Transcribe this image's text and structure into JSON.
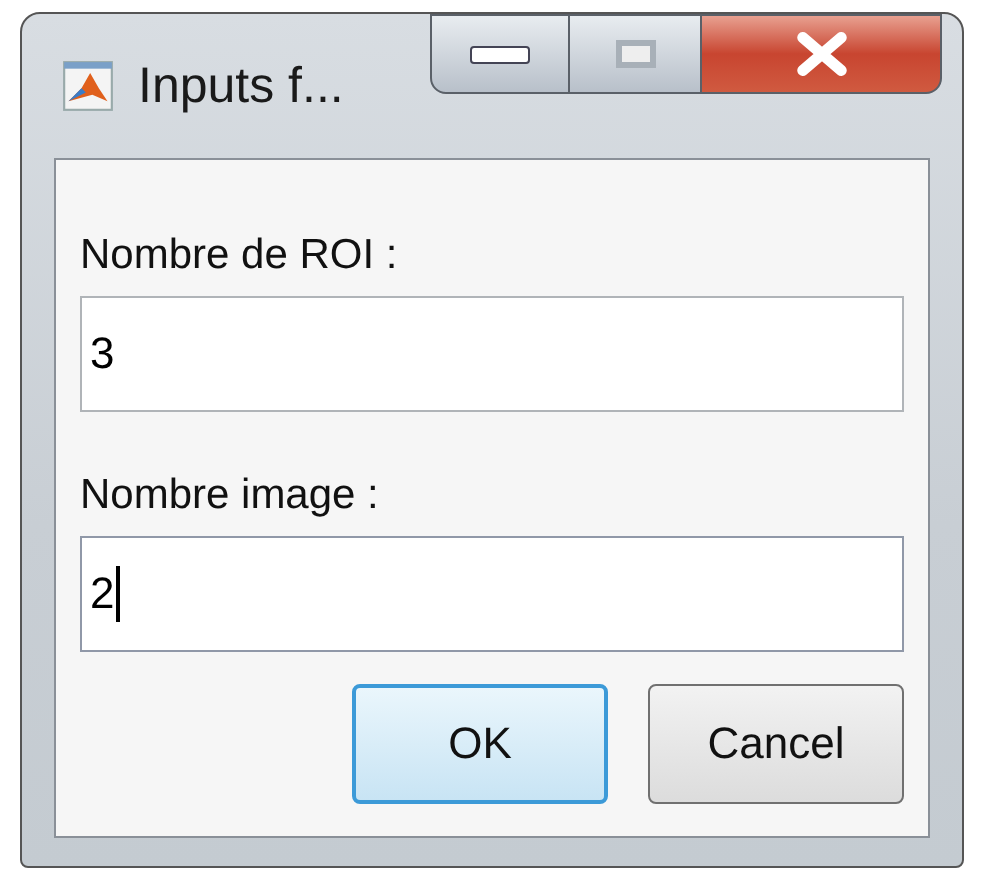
{
  "window": {
    "title": "Inputs f...",
    "maximize_disabled": true
  },
  "fields": [
    {
      "label": "Nombre de ROI :",
      "value": "3",
      "focused": false
    },
    {
      "label": "Nombre image :",
      "value": "2",
      "focused": true
    }
  ],
  "buttons": [
    {
      "label": "OK",
      "default": true
    },
    {
      "label": "Cancel",
      "default": false
    }
  ]
}
